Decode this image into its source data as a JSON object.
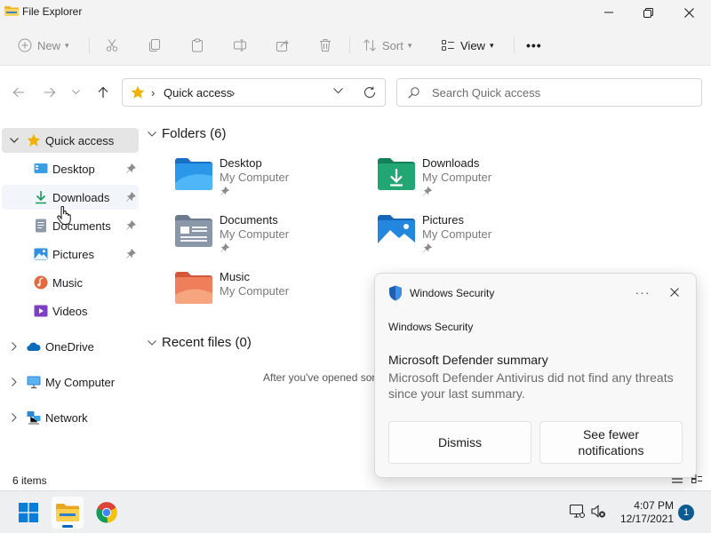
{
  "window": {
    "title": "File Explorer",
    "accent": "#0067c0"
  },
  "commandbar": {
    "new_label": "New",
    "sort_label": "Sort",
    "view_label": "View",
    "more_label": "•••"
  },
  "address": {
    "crumb": "Quick access",
    "search_placeholder": "Search Quick access"
  },
  "sidebar": {
    "quick_access": "Quick access",
    "items": [
      {
        "label": "Desktop",
        "icon": "desktop-icon",
        "pinned": true
      },
      {
        "label": "Downloads",
        "icon": "downloads-icon",
        "pinned": true
      },
      {
        "label": "Documents",
        "icon": "documents-icon",
        "pinned": true
      },
      {
        "label": "Pictures",
        "icon": "pictures-icon",
        "pinned": true
      },
      {
        "label": "Music",
        "icon": "music-icon",
        "pinned": false
      },
      {
        "label": "Videos",
        "icon": "videos-icon",
        "pinned": false
      }
    ],
    "roots": [
      {
        "label": "OneDrive",
        "icon": "onedrive-icon"
      },
      {
        "label": "My Computer",
        "icon": "computer-icon"
      },
      {
        "label": "Network",
        "icon": "network-icon"
      }
    ]
  },
  "content": {
    "folders_header": "Folders (6)",
    "folders": [
      {
        "name": "Desktop",
        "location": "My Computer",
        "icon": "desktop-folder-icon"
      },
      {
        "name": "Downloads",
        "location": "My Computer",
        "icon": "downloads-folder-icon"
      },
      {
        "name": "Documents",
        "location": "My Computer",
        "icon": "documents-folder-icon"
      },
      {
        "name": "Pictures",
        "location": "My Computer",
        "icon": "pictures-folder-icon"
      },
      {
        "name": "Music",
        "location": "My Computer",
        "icon": "music-folder-icon"
      }
    ],
    "recent_header": "Recent files (0)",
    "recent_hint": "After you've opened sor"
  },
  "status": {
    "items_count": "6 items"
  },
  "toast": {
    "app_name": "Windows Security",
    "more_label": "···",
    "source": "Windows Security",
    "title": "Microsoft Defender summary",
    "body": "Microsoft Defender Antivirus did not find any threats since your last summary.",
    "dismiss_label": "Dismiss",
    "fewer_label": "See fewer notifications"
  },
  "taskbar": {
    "time": "4:07 PM",
    "date": "12/17/2021",
    "notification_count": "1"
  }
}
